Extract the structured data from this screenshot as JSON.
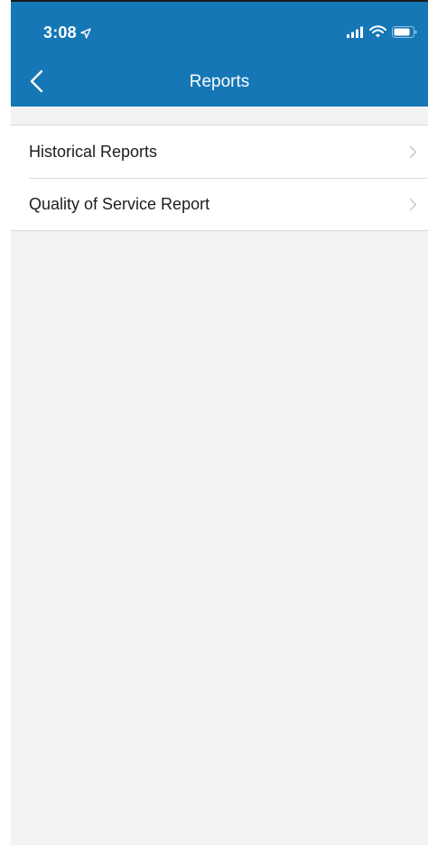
{
  "status_bar": {
    "time": "3:08",
    "icons": [
      "location-arrow-icon",
      "signal-bars-icon",
      "wifi-icon",
      "battery-icon"
    ]
  },
  "nav": {
    "title": "Reports",
    "back_icon": "chevron-left-icon"
  },
  "reports_list": {
    "items": [
      {
        "label": "Historical Reports",
        "icon": "chevron-right-icon"
      },
      {
        "label": "Quality of Service Report",
        "icon": "chevron-right-icon"
      }
    ]
  },
  "colors": {
    "header_blue": "#1577b5",
    "background": "#f3f3f3",
    "row_background": "#ffffff",
    "chevron_gray": "#c4c4c4"
  }
}
